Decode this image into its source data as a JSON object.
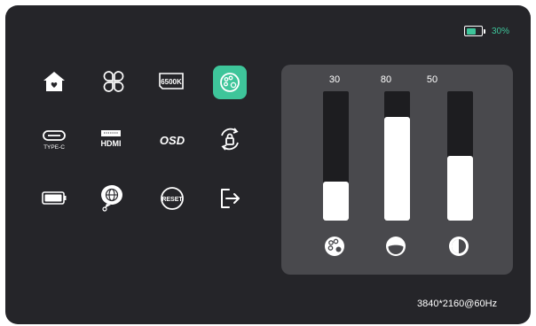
{
  "battery": {
    "percent_label": "30%",
    "level": 0.3
  },
  "menu": {
    "items": [
      {
        "name": "home",
        "icon": "home-icon"
      },
      {
        "name": "layout",
        "icon": "four-leaf-layout-icon"
      },
      {
        "name": "color-temperature",
        "icon": "color-temp-icon",
        "label": "6500K"
      },
      {
        "name": "picture",
        "icon": "palette-icon",
        "selected": true
      },
      {
        "name": "type-c",
        "icon": "type-c-icon",
        "label": "TYPE-C"
      },
      {
        "name": "hdmi",
        "icon": "hdmi-icon",
        "label": "HDMI"
      },
      {
        "name": "osd",
        "icon": "osd-icon",
        "label": "OSD"
      },
      {
        "name": "lock-rotate",
        "icon": "rotate-lock-icon"
      },
      {
        "name": "battery",
        "icon": "battery-icon"
      },
      {
        "name": "language",
        "icon": "globe-icon"
      },
      {
        "name": "reset",
        "icon": "reset-icon",
        "label": "RESET"
      },
      {
        "name": "exit",
        "icon": "exit-icon"
      }
    ]
  },
  "sliders": [
    {
      "name": "color",
      "icon": "palette-icon",
      "value_label": "30",
      "value": 30
    },
    {
      "name": "saturation",
      "icon": "saturation-icon",
      "value_label": "80",
      "value": 80
    },
    {
      "name": "contrast",
      "icon": "contrast-icon",
      "value_label": "50",
      "value": 50
    }
  ],
  "resolution": "3840*2160@60Hz",
  "colors": {
    "accent": "#3ec59a",
    "background": "#252529",
    "panel": "#49494d"
  }
}
